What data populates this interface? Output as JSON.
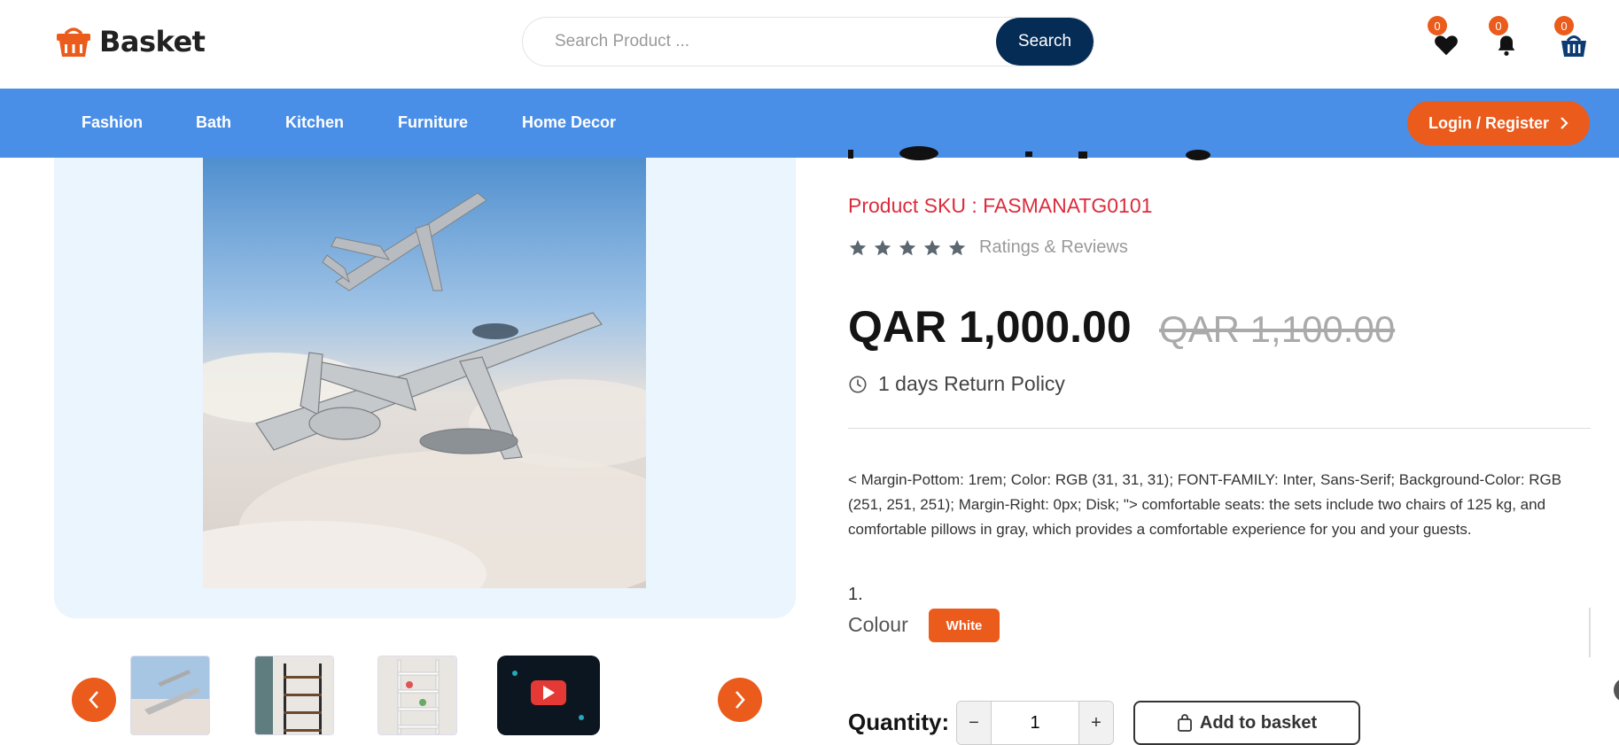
{
  "header": {
    "logo_text": "Basket",
    "search_placeholder": "Search Product ...",
    "search_button": "Search",
    "wishlist_count": "0",
    "notifications_count": "0",
    "cart_count": "0"
  },
  "nav": {
    "items": [
      "Fashion",
      "Bath",
      "Kitchen",
      "Furniture",
      "Home Decor"
    ],
    "login_label": "Login / Register"
  },
  "product": {
    "sku_label": "Product SKU : FASMANATG0101",
    "ratings_label": "Ratings & Reviews",
    "rating_stars": 5,
    "price": "QAR 1,000.00",
    "old_price": "QAR 1,100.00",
    "return_policy": "1 days Return Policy",
    "description": "< Margin-Pottom: 1rem; Color: RGB (31, 31, 31); FONT-FAMILY: Inter, Sans-Serif; Background-Color: RGB (251, 251, 251); Margin-Right: 0px; Disk; \"> comfortable seats: the sets include two chairs of 125 kg, and comfortable pillows in gray, which provides a comfortable experience for you and your guests.",
    "list_number": "1.",
    "colour_label": "Colour",
    "colour_value": "White",
    "quantity_label": "Quantity:",
    "quantity_value": "1",
    "qty_minus": "−",
    "qty_plus": "+",
    "add_to_basket": "Add to basket"
  },
  "colors": {
    "brand_orange": "#ea5b1c",
    "nav_blue": "#4a8fe7",
    "search_navy": "#052c55",
    "sku_red": "#dc2c3c"
  }
}
